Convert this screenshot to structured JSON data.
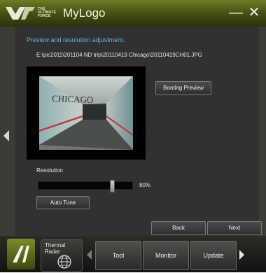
{
  "window": {
    "title": "MyLogo",
    "logo_text": [
      "THE",
      "ULTIMATE",
      "FORCE"
    ],
    "minimize_glyph": "—",
    "close_glyph": "✕"
  },
  "panel": {
    "heading": "Preview and resolution adjustment.",
    "file_path": "E:\\pic2011\\201104 ND trip\\20110419 Chicago\\20110419CH01.JPG",
    "booting_preview_label": "Booting Preview",
    "photo_caption": "CHICAGO",
    "resolution_label": "Resolution",
    "resolution_value": "80%",
    "resolution_level": 0.8,
    "auto_tune_label": "Auto Tune",
    "back_label": "Back",
    "next_label": "Next"
  },
  "dock": {
    "thermal_radar_label": "Thermal Radar",
    "tabs": [
      "Tool",
      "Monitor",
      "Update"
    ]
  },
  "colors": {
    "accent": "#5cb4ea",
    "title_bar": "#4a5314"
  }
}
